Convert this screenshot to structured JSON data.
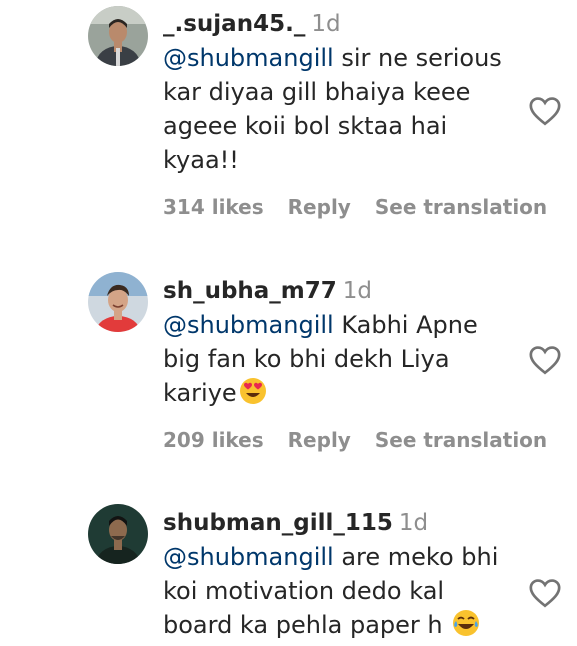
{
  "comments": [
    {
      "username": "_.sujan45._",
      "time": "1d",
      "mention": "@shubmangill",
      "text_lines": [
        " sir ne serious",
        "kar diyaa gill bhaiya keee",
        "ageee koii bol sktaa hai",
        "kyaa!!"
      ],
      "likes": "314 likes",
      "reply": "Reply",
      "translate": "See translation",
      "avatar_colors": {
        "bg": "#9aa39b",
        "skin": "#b98a6c",
        "hair": "#2b2622",
        "cloth": "#3a3f45"
      },
      "heart_icon": "heart-outline"
    },
    {
      "username": "sh_ubha_m77",
      "time": "1d",
      "mention": "@shubmangill",
      "text_lines": [
        " Kabhi Apne",
        "big fan ko bhi dekh Liya",
        "kariye"
      ],
      "emoji": "heart-eyes",
      "likes": "209 likes",
      "reply": "Reply",
      "translate": "See translation",
      "avatar_colors": {
        "bg": "#cfd8e0",
        "skin": "#d4a487",
        "hair": "#3a2a20",
        "cloth": "#e23b3b"
      },
      "heart_icon": "heart-outline"
    },
    {
      "username": "shubman_gill_115",
      "time": "1d",
      "mention": "@shubmangill",
      "text_lines": [
        " are meko bhi",
        "koi motivation dedo kal",
        "board ka pehla paper h "
      ],
      "emoji": "laughing-tears",
      "avatar_colors": {
        "bg": "#1f3b34",
        "skin": "#8d6a4e",
        "hair": "#121312",
        "cloth": "#16241f"
      },
      "heart_icon": "heart-outline"
    }
  ]
}
